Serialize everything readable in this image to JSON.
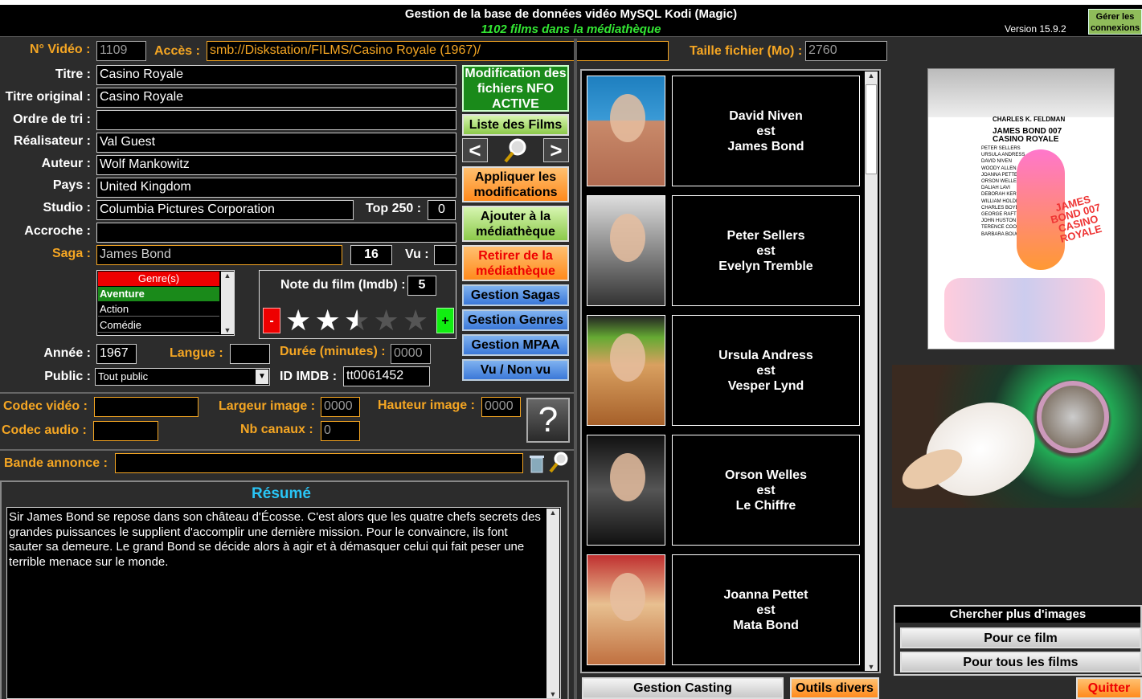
{
  "header": {
    "title": "Gestion de la base de données vidéo MySQL Kodi (Magic)",
    "subtitle": "1102 films dans la médiathèque",
    "version": "Version 15.9.2",
    "connections_button": "Gérer les connexions"
  },
  "fields": {
    "video_no_label": "N° Vidéo :",
    "video_no": "1109",
    "access_label": "Accès :",
    "access": "smb://Diskstation/FILMS/Casino Royale (1967)/",
    "filesize_label": "Taille fichier (Mo) :",
    "filesize": "2760",
    "title_label": "Titre :",
    "title": "Casino Royale",
    "original_title_label": "Titre original :",
    "original_title": "Casino Royale",
    "sort_label": "Ordre de tri :",
    "sort": "",
    "director_label": "Réalisateur :",
    "director": "Val Guest",
    "author_label": "Auteur :",
    "author": "Wolf Mankowitz",
    "country_label": "Pays :",
    "country": "United Kingdom",
    "studio_label": "Studio :",
    "studio": "Columbia Pictures Corporation",
    "top250_label": "Top 250 :",
    "top250": "0",
    "tagline_label": "Accroche :",
    "tagline": "",
    "saga_label": "Saga :",
    "saga": "James Bond",
    "saga_count": "16",
    "seen_label": "Vu :",
    "seen": "",
    "year_label": "Année :",
    "year": "1967",
    "language_label": "Langue :",
    "language": "",
    "duration_label": "Durée (minutes) :",
    "duration": "0000",
    "public_label": "Public :",
    "public": "Tout public",
    "imdb_label": "ID IMDB :",
    "imdb": "tt0061452"
  },
  "genres": {
    "header": "Genre(s)",
    "items": [
      "Aventure",
      "Action",
      "Comédie"
    ]
  },
  "rating": {
    "label": "Note du film (Imdb) :",
    "value": "5",
    "stars_filled": 2.5,
    "stars_total": 5,
    "minus": "-",
    "plus": "+"
  },
  "buttons": {
    "nfo": "Modification des fichiers NFO ACTIVE",
    "film_list": "Liste des Films",
    "prev": "<",
    "next": ">",
    "apply": "Appliquer les modifications",
    "add": "Ajouter à la médiathèque",
    "remove": "Retirer de la médiathèque",
    "sagas": "Gestion Sagas",
    "genres": "Gestion Genres",
    "mpaa": "Gestion MPAA",
    "seen_toggle": "Vu / Non vu",
    "help": "?",
    "casting": "Gestion Casting",
    "tools": "Outils divers",
    "quit": "Quitter"
  },
  "technical": {
    "video_codec_label": "Codec vidéo :",
    "video_codec": "",
    "audio_codec_label": "Codec audio :",
    "audio_codec": "",
    "width_label": "Largeur image :",
    "width": "0000",
    "height_label": "Hauteur image :",
    "height": "0000",
    "channels_label": "Nb canaux :",
    "channels": "0"
  },
  "trailer": {
    "label": "Bande annonce :",
    "value": ""
  },
  "summary": {
    "title": "Résumé",
    "text": "Sir James Bond se repose dans son château d'Écosse. C'est alors que les quatre chefs secrets des grandes puissances le supplient d'accomplir une dernière mission. Pour le convaincre, ils font sauter sa demeure. Le grand Bond se décide alors à agir et à démasquer celui qui fait peser une terrible menace sur le monde."
  },
  "cast": [
    {
      "actor": "David Niven",
      "est": "est",
      "role": "James Bond"
    },
    {
      "actor": "Peter Sellers",
      "est": "est",
      "role": "Evelyn Tremble"
    },
    {
      "actor": "Ursula Andress",
      "est": "est",
      "role": "Vesper Lynd"
    },
    {
      "actor": "Orson Welles",
      "est": "est",
      "role": "Le Chiffre"
    },
    {
      "actor": "Joanna Pettet",
      "est": "est",
      "role": "Mata Bond"
    }
  ],
  "poster": {
    "line1": "CHARLES K. FELDMAN",
    "line2": "JAMES BOND 007",
    "line3": "CASINO ROYALE",
    "names": [
      "PETER SELLERS",
      "URSULA ANDRESS",
      "DAVID NIVEN",
      "WOODY ALLEN",
      "JOANNA PETTET",
      "ORSON WELLES",
      "DALIAH LAVI",
      "DEBORAH KERR",
      "WILLIAM HOLDEN",
      "CHARLES BOYER",
      "GEORGE RAFT",
      "JOHN HUSTON",
      "TERENCE COOPER",
      "BARBARA BOUCHET"
    ],
    "logo": "JAMES BOND 007 CASINO ROYALE"
  },
  "images": {
    "search_title": "Chercher plus d'images",
    "this_film": "Pour ce film",
    "all_films": "Pour tous les films"
  },
  "colors": {
    "accent_orange": "#f5a623",
    "green": "#1a8a1a",
    "blue": "#3b78d8",
    "summary_title": "#29c5f6"
  }
}
